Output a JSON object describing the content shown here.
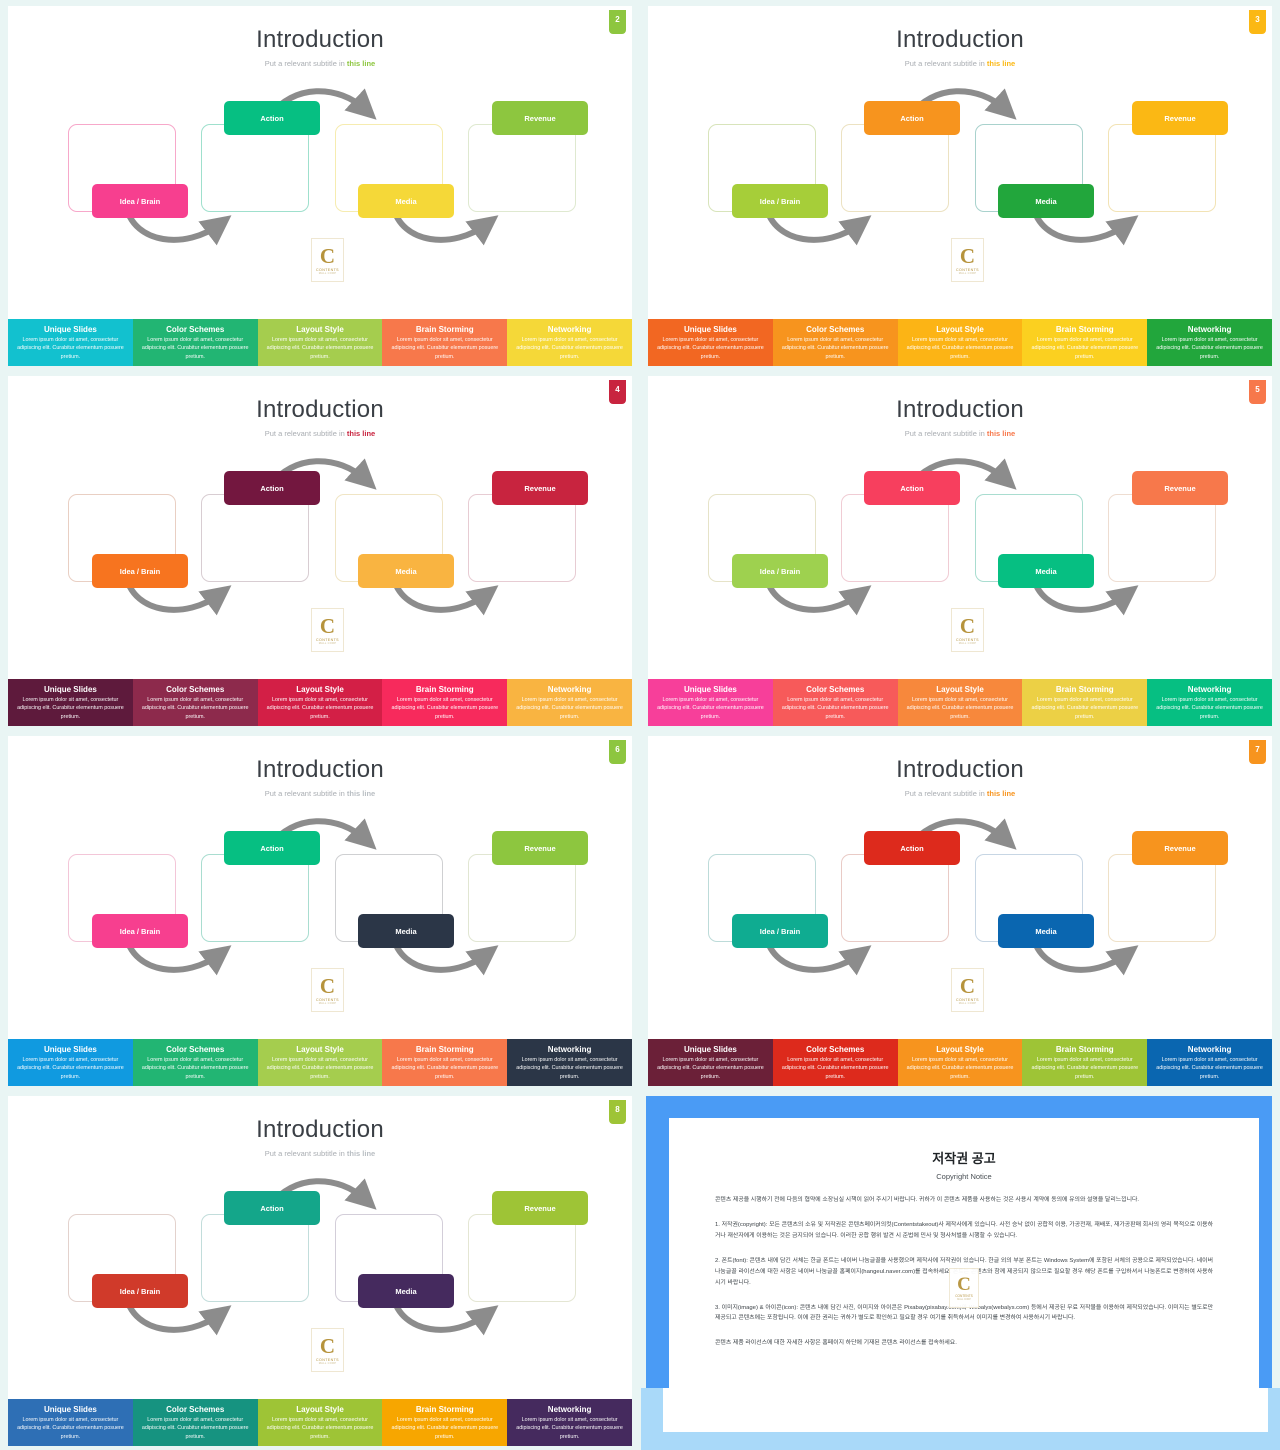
{
  "page": {
    "background": "#e9f5f4",
    "slide_count": 7
  },
  "common": {
    "title": "Introduction",
    "subtitle_plain": "Put a relevant subtitle in ",
    "subtitle_accent": "this line",
    "logo": {
      "glyph": "C",
      "line1": "CONTENTS",
      "line2": "MALL  CORP"
    },
    "node_labels": {
      "idea": "Idea / Brain",
      "action": "Action",
      "media": "Media",
      "revenue": "Revenue"
    },
    "footer_titles": [
      "Unique Slides",
      "Color Schemes",
      "Layout Style",
      "Brain Storming",
      "Networking"
    ],
    "footer_body": "Lorem ipsum dolor sit amet, consectetur adipiscing elit. Curabitur elementum posuere pretium."
  },
  "slides": [
    {
      "page_number": "2",
      "badge_color": "#8dc63f",
      "accent": "#8dc63f",
      "nodes": {
        "idea": {
          "fill": "#f73f8f",
          "outline": "#f7a8ca"
        },
        "action": {
          "fill": "#06bf82",
          "outline": "#9fe0cd"
        },
        "media": {
          "fill": "#f5d838",
          "outline": "#f6ecb0"
        },
        "revenue": {
          "fill": "#8dc63f",
          "outline": "#dfe9d0"
        }
      },
      "footer_colors": [
        "#12c1cf",
        "#22b573",
        "#a5cd4e",
        "#f7784b",
        "#f5d838"
      ]
    },
    {
      "page_number": "3",
      "badge_color": "#fbb814",
      "accent": "#fbb814",
      "nodes": {
        "idea": {
          "fill": "#a6ce39",
          "outline": "#d8e4bb"
        },
        "action": {
          "fill": "#f7941e",
          "outline": "#ece2c2"
        },
        "media": {
          "fill": "#22a63c",
          "outline": "#a9d2cd"
        },
        "revenue": {
          "fill": "#fbb814",
          "outline": "#f2e3b5"
        }
      },
      "footer_colors": [
        "#f26722",
        "#f7941e",
        "#fcb415",
        "#fbd020",
        "#22a63c"
      ]
    },
    {
      "page_number": "4",
      "badge_color": "#c8243f",
      "accent": "#c8243f",
      "nodes": {
        "idea": {
          "fill": "#f7741f",
          "outline": "#e9cfc3"
        },
        "action": {
          "fill": "#73173f",
          "outline": "#d8cdd2"
        },
        "media": {
          "fill": "#f9b441",
          "outline": "#f0e5c5"
        },
        "revenue": {
          "fill": "#c8243f",
          "outline": "#e7ccd3"
        }
      },
      "footer_colors": [
        "#5e1a3c",
        "#8d2a4c",
        "#d31f46",
        "#f72a5c",
        "#f9b441"
      ]
    },
    {
      "page_number": "5",
      "badge_color": "#f7784b",
      "accent": "#f7784b",
      "nodes": {
        "idea": {
          "fill": "#9ed14f",
          "outline": "#e6e3c8"
        },
        "action": {
          "fill": "#f73f5e",
          "outline": "#f0ccd4"
        },
        "media": {
          "fill": "#06bf82",
          "outline": "#a9ddd0"
        },
        "revenue": {
          "fill": "#f7784b",
          "outline": "#eeddd1"
        }
      },
      "footer_colors": [
        "#f73f9a",
        "#f75a5a",
        "#f7883c",
        "#ecd045",
        "#06bf82"
      ]
    },
    {
      "page_number": "6",
      "badge_color": "#8dc63f",
      "accent": "#b9bec3",
      "nodes": {
        "idea": {
          "fill": "#f73f8f",
          "outline": "#f3c6d8"
        },
        "action": {
          "fill": "#06bf82",
          "outline": "#a9ddd0"
        },
        "media": {
          "fill": "#2b3647",
          "outline": "#cfd0d2"
        },
        "revenue": {
          "fill": "#8dc63f",
          "outline": "#e1e6d2"
        }
      },
      "footer_colors": [
        "#109ae0",
        "#22b573",
        "#a5cd4e",
        "#f7784b",
        "#2b3647"
      ]
    },
    {
      "page_number": "7",
      "badge_color": "#f7941e",
      "accent": "#f7941e",
      "nodes": {
        "idea": {
          "fill": "#0fac91",
          "outline": "#bddbd9"
        },
        "action": {
          "fill": "#dd2a1c",
          "outline": "#e9cbc6"
        },
        "media": {
          "fill": "#0a66b0",
          "outline": "#c7d6e4"
        },
        "revenue": {
          "fill": "#f7941e",
          "outline": "#efe1c8"
        }
      },
      "footer_colors": [
        "#6b2038",
        "#dd2a1c",
        "#f7941e",
        "#9ec436",
        "#0a66b0"
      ]
    },
    {
      "page_number": "8",
      "badge_color": "#9ec436",
      "accent": "#b9bec3",
      "nodes": {
        "idea": {
          "fill": "#d03a2a",
          "outline": "#e3d2cd"
        },
        "action": {
          "fill": "#14a68a",
          "outline": "#c2dddb"
        },
        "media": {
          "fill": "#452a5e",
          "outline": "#d3ced9"
        },
        "revenue": {
          "fill": "#9ec436",
          "outline": "#e4e6d3"
        }
      },
      "footer_colors": [
        "#2e6fb5",
        "#169380",
        "#9ec436",
        "#f7a600",
        "#452a5e"
      ]
    }
  ],
  "copyright": {
    "frame_color": "#4a9bf5",
    "title": "저작권 공고",
    "subtitle": "Copyright Notice",
    "intro": "콘텐츠 제공을 시행하기 전에 다음의 협약에 소장님실 시책이 읽어 주시기 바랍니다. 귀하가 이 콘텐츠 제품을 사용하는 것은 사용시 계약에 동의에 유의와 설명을 달리느낍니다.",
    "item1": "1. 저작권(copyright): 모든 콘텐츠의 소유 및 저작권은 콘텐츠메이커의컷(Contentstakeout)사 제작사에게 있습니다. 사전 승낙 없이 공합적 이용, 가공전재, 재배포, 재가공판매 회사의 영리 목적으로 이용하거나 재산자에게 이용하는 것은 금지되어 있습니다. 이러한 공합 행위 발견 시 준법에 민사 및 형사처벌을 시행할 수 있습니다.",
    "item2": "2. 폰트(font): 콘텐츠 내에 담긴 서체는 한글 폰트는 네이버 나눔글꼴을 사용했으며 제작사에 저작권이 있습니다. 한글 외의 부분 폰트는 Windows System에 포함된 서체의 공용으로 제작되었습니다. 네이버 나눔글꼴 라이선스에 대한 사항은 네이버 나눔글꼴 홈페이지(hangeul.naver.com)를 접속하세요. 폰트는 콘텐츠와 함께 제공되지 않으므로 필요할 경우 해당 폰트를 구입하셔서 나눔폰트로 변경하여 사용하시기 바랍니다.",
    "item3": "3. 이미지(image) & 아이콘(icon): 콘텐츠 내에 담긴 사진, 이미지와 아이콘은 Pixabay(pixabay.com)와 Webalys(webalys.com) 등에서 제공된 무료 저작물을 이용하여 제작되었습니다. 이미지는 별도로만 제공되고 콘텐츠에는 포함됩니다. 이에 관한 권리는 귀하가 별도로 확인하고 필요할 경우 여기를 취득하셔서 이미지를 변경하여 사용하시기 바랍니다.",
    "footer_note": "콘텐츠 제품 라이선스에 대한 자세한 사항은 홈페이지 하단에 기재된 콘텐츠 라이선스를 접속하세요."
  }
}
